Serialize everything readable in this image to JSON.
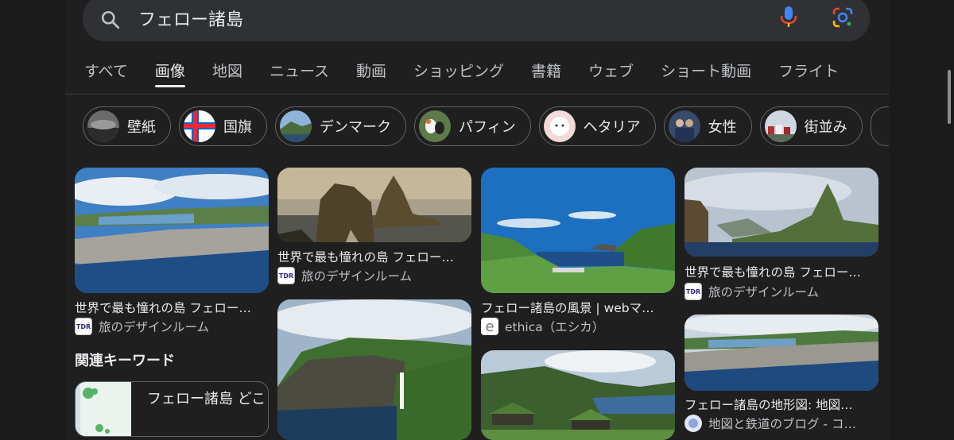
{
  "search": {
    "query": "フェロー諸島"
  },
  "tabs": [
    {
      "label": "すべて"
    },
    {
      "label": "画像"
    },
    {
      "label": "地図"
    },
    {
      "label": "ニュース"
    },
    {
      "label": "動画"
    },
    {
      "label": "ショッピング"
    },
    {
      "label": "書籍"
    },
    {
      "label": "ウェブ"
    },
    {
      "label": "ショート動画"
    },
    {
      "label": "フライト"
    }
  ],
  "active_tab": "画像",
  "chips": [
    {
      "label": "壁紙"
    },
    {
      "label": "国旗"
    },
    {
      "label": "デンマーク"
    },
    {
      "label": "パフィン"
    },
    {
      "label": "ヘタリア"
    },
    {
      "label": "女性"
    },
    {
      "label": "街並み"
    }
  ],
  "results": [
    {
      "caption": "世界で最も憧れの島 フェロー…",
      "source": "旅のデザインルーム"
    },
    {
      "caption": "世界で最も憧れの島 フェロー…",
      "source": "旅のデザインルーム"
    },
    {
      "caption": "フェロー諸島の風景 | webマ…",
      "source": "ethica（エシカ）"
    },
    {
      "caption": "世界で最も憧れの島 フェロー…",
      "source": "旅のデザインルーム"
    },
    {
      "caption": "フェロー諸島の地形図: 地図…",
      "source": "地図と鉄道のブログ - コ…"
    }
  ],
  "related": {
    "title": "関連キーワード",
    "items": [
      {
        "label": "フェロー諸島 どこ"
      }
    ]
  },
  "favicons": {
    "tdr": "TDR",
    "ethica": "e"
  },
  "colors": {
    "background": "#1f1f1f",
    "search_bg": "#303134",
    "text": "#e8eaed",
    "muted_text": "#bdc1c6",
    "chip_border": "#5f6368",
    "mic_blue": "#4285f4",
    "mic_red": "#ea4335"
  },
  "icons": [
    "search-icon",
    "microphone-icon",
    "google-lens-icon"
  ]
}
